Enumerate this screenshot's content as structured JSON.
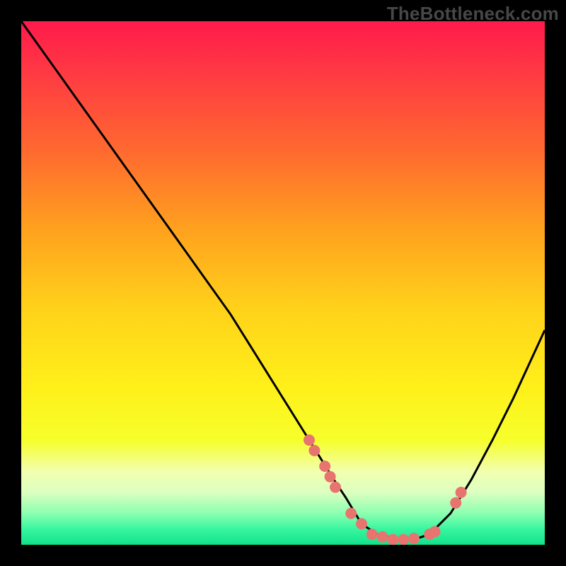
{
  "watermark": "TheBottleneck.com",
  "chart_data": {
    "type": "line",
    "title": "",
    "xlabel": "",
    "ylabel": "",
    "xlim": [
      0,
      100
    ],
    "ylim": [
      0,
      100
    ],
    "curve": {
      "x": [
        0,
        5,
        10,
        15,
        20,
        25,
        30,
        35,
        40,
        45,
        50,
        55,
        60,
        62,
        65,
        68,
        72,
        75,
        78,
        82,
        86,
        90,
        94,
        100
      ],
      "y": [
        100,
        93,
        86,
        79,
        72,
        65,
        58,
        51,
        44,
        36,
        28,
        20,
        12,
        9,
        4,
        2,
        1,
        1,
        2,
        6,
        12.5,
        20,
        28,
        41
      ]
    },
    "markers": {
      "x": [
        55,
        56,
        58,
        59,
        60,
        63,
        65,
        67,
        69,
        71,
        73,
        75,
        78,
        79,
        83,
        84
      ],
      "y": [
        20,
        18,
        15,
        13,
        11,
        6,
        4,
        2,
        1.5,
        1,
        1,
        1.2,
        2,
        2.5,
        8,
        10
      ]
    },
    "gradient_stops": [
      {
        "offset": 0.0,
        "color": "#ff1a4b"
      },
      {
        "offset": 0.1,
        "color": "#ff3a43"
      },
      {
        "offset": 0.25,
        "color": "#ff6a2f"
      },
      {
        "offset": 0.4,
        "color": "#ffa21e"
      },
      {
        "offset": 0.55,
        "color": "#ffd21a"
      },
      {
        "offset": 0.7,
        "color": "#fff01a"
      },
      {
        "offset": 0.8,
        "color": "#f6ff2a"
      },
      {
        "offset": 0.86,
        "color": "#f2ffb0"
      },
      {
        "offset": 0.9,
        "color": "#dcffc0"
      },
      {
        "offset": 0.94,
        "color": "#8bffb0"
      },
      {
        "offset": 0.97,
        "color": "#38f6a0"
      },
      {
        "offset": 1.0,
        "color": "#12e28a"
      }
    ],
    "marker_color": "#e87470",
    "curve_color": "#000000"
  }
}
